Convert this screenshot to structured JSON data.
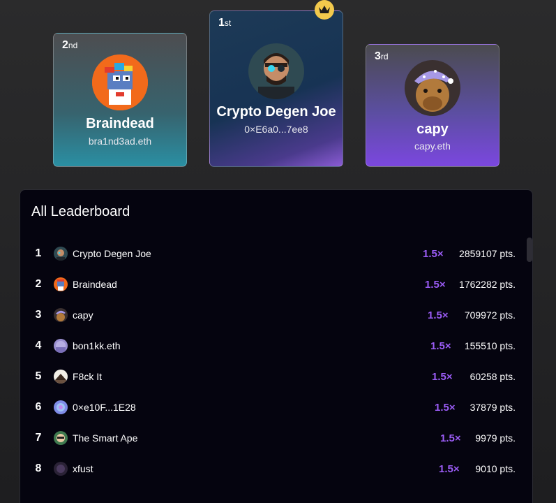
{
  "podium": {
    "second": {
      "rank_num": "2",
      "rank_suffix": "nd",
      "name": "Braindead",
      "handle": "bra1nd3ad.eth"
    },
    "first": {
      "rank_num": "1",
      "rank_suffix": "st",
      "name": "Crypto Degen Joe",
      "handle": "0×E6a0...7ee8"
    },
    "third": {
      "rank_num": "3",
      "rank_suffix": "rd",
      "name": "capy",
      "handle": "capy.eth"
    }
  },
  "leaderboard": {
    "title": "All Leaderboard",
    "rows": [
      {
        "rank": "1",
        "name": "Crypto Degen Joe",
        "multiplier": "1.5×",
        "points": "2859107 pts."
      },
      {
        "rank": "2",
        "name": "Braindead",
        "multiplier": "1.5×",
        "points": "1762282 pts."
      },
      {
        "rank": "3",
        "name": "capy",
        "multiplier": "1.5×",
        "points": "709972 pts."
      },
      {
        "rank": "4",
        "name": "bon1kk.eth",
        "multiplier": "1.5×",
        "points": "155510 pts."
      },
      {
        "rank": "5",
        "name": "F8ck It",
        "multiplier": "1.5×",
        "points": "60258 pts."
      },
      {
        "rank": "6",
        "name": "0×e10F...1E28",
        "multiplier": "1.5×",
        "points": "37879 pts."
      },
      {
        "rank": "7",
        "name": "The Smart Ape",
        "multiplier": "1.5×",
        "points": "9979 pts."
      },
      {
        "rank": "8",
        "name": "xfust",
        "multiplier": "1.5×",
        "points": "9010 pts."
      }
    ]
  },
  "colors": {
    "accent": "#9b5cf6",
    "crown": "#f2c94c",
    "panel_bg": "#05040f"
  }
}
